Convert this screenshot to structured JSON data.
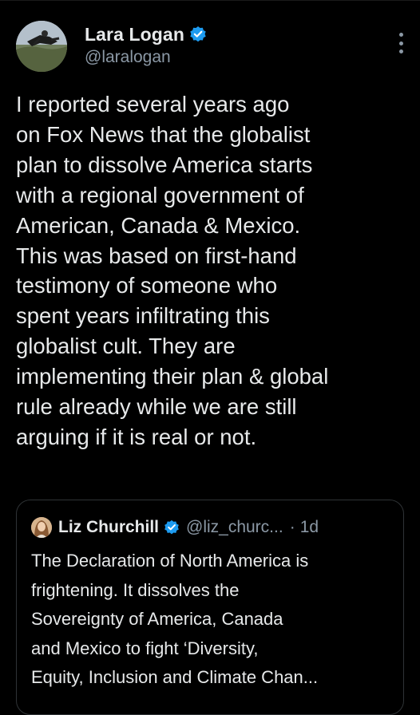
{
  "theme": {
    "background": "#000000",
    "text_primary": "#e7e9ea",
    "text_secondary": "#8b98a5",
    "verified_blue": "#1d9bf0",
    "border": "#2f3336"
  },
  "tweet": {
    "author": {
      "display_name": "Lara Logan",
      "handle": "@laralogan",
      "verified": true,
      "avatar_icon": "avatar-photo"
    },
    "more_icon": "more-vertical-icon",
    "text_lines": [
      "I reported several years ago",
      "on Fox News that the globalist",
      "plan to dissolve America starts",
      "with a regional government of",
      "American, Canada & Mexico.",
      "This was based on first-hand",
      "testimony of someone who",
      "spent years infiltrating this",
      "globalist cult. They are",
      "implementing their plan & global",
      "rule already while we are still",
      "arguing if it is real or not."
    ],
    "quoted": {
      "author": {
        "display_name": "Liz Churchill",
        "handle": "@liz_churc...",
        "verified": true,
        "avatar_icon": "avatar-photo"
      },
      "separator": "·",
      "time": "1d",
      "text_lines": [
        "The Declaration of North America is",
        "frightening. It dissolves the",
        "Sovereignty of America, Canada",
        "and Mexico to fight ‘Diversity,",
        "Equity, Inclusion and Climate Chan..."
      ]
    }
  }
}
